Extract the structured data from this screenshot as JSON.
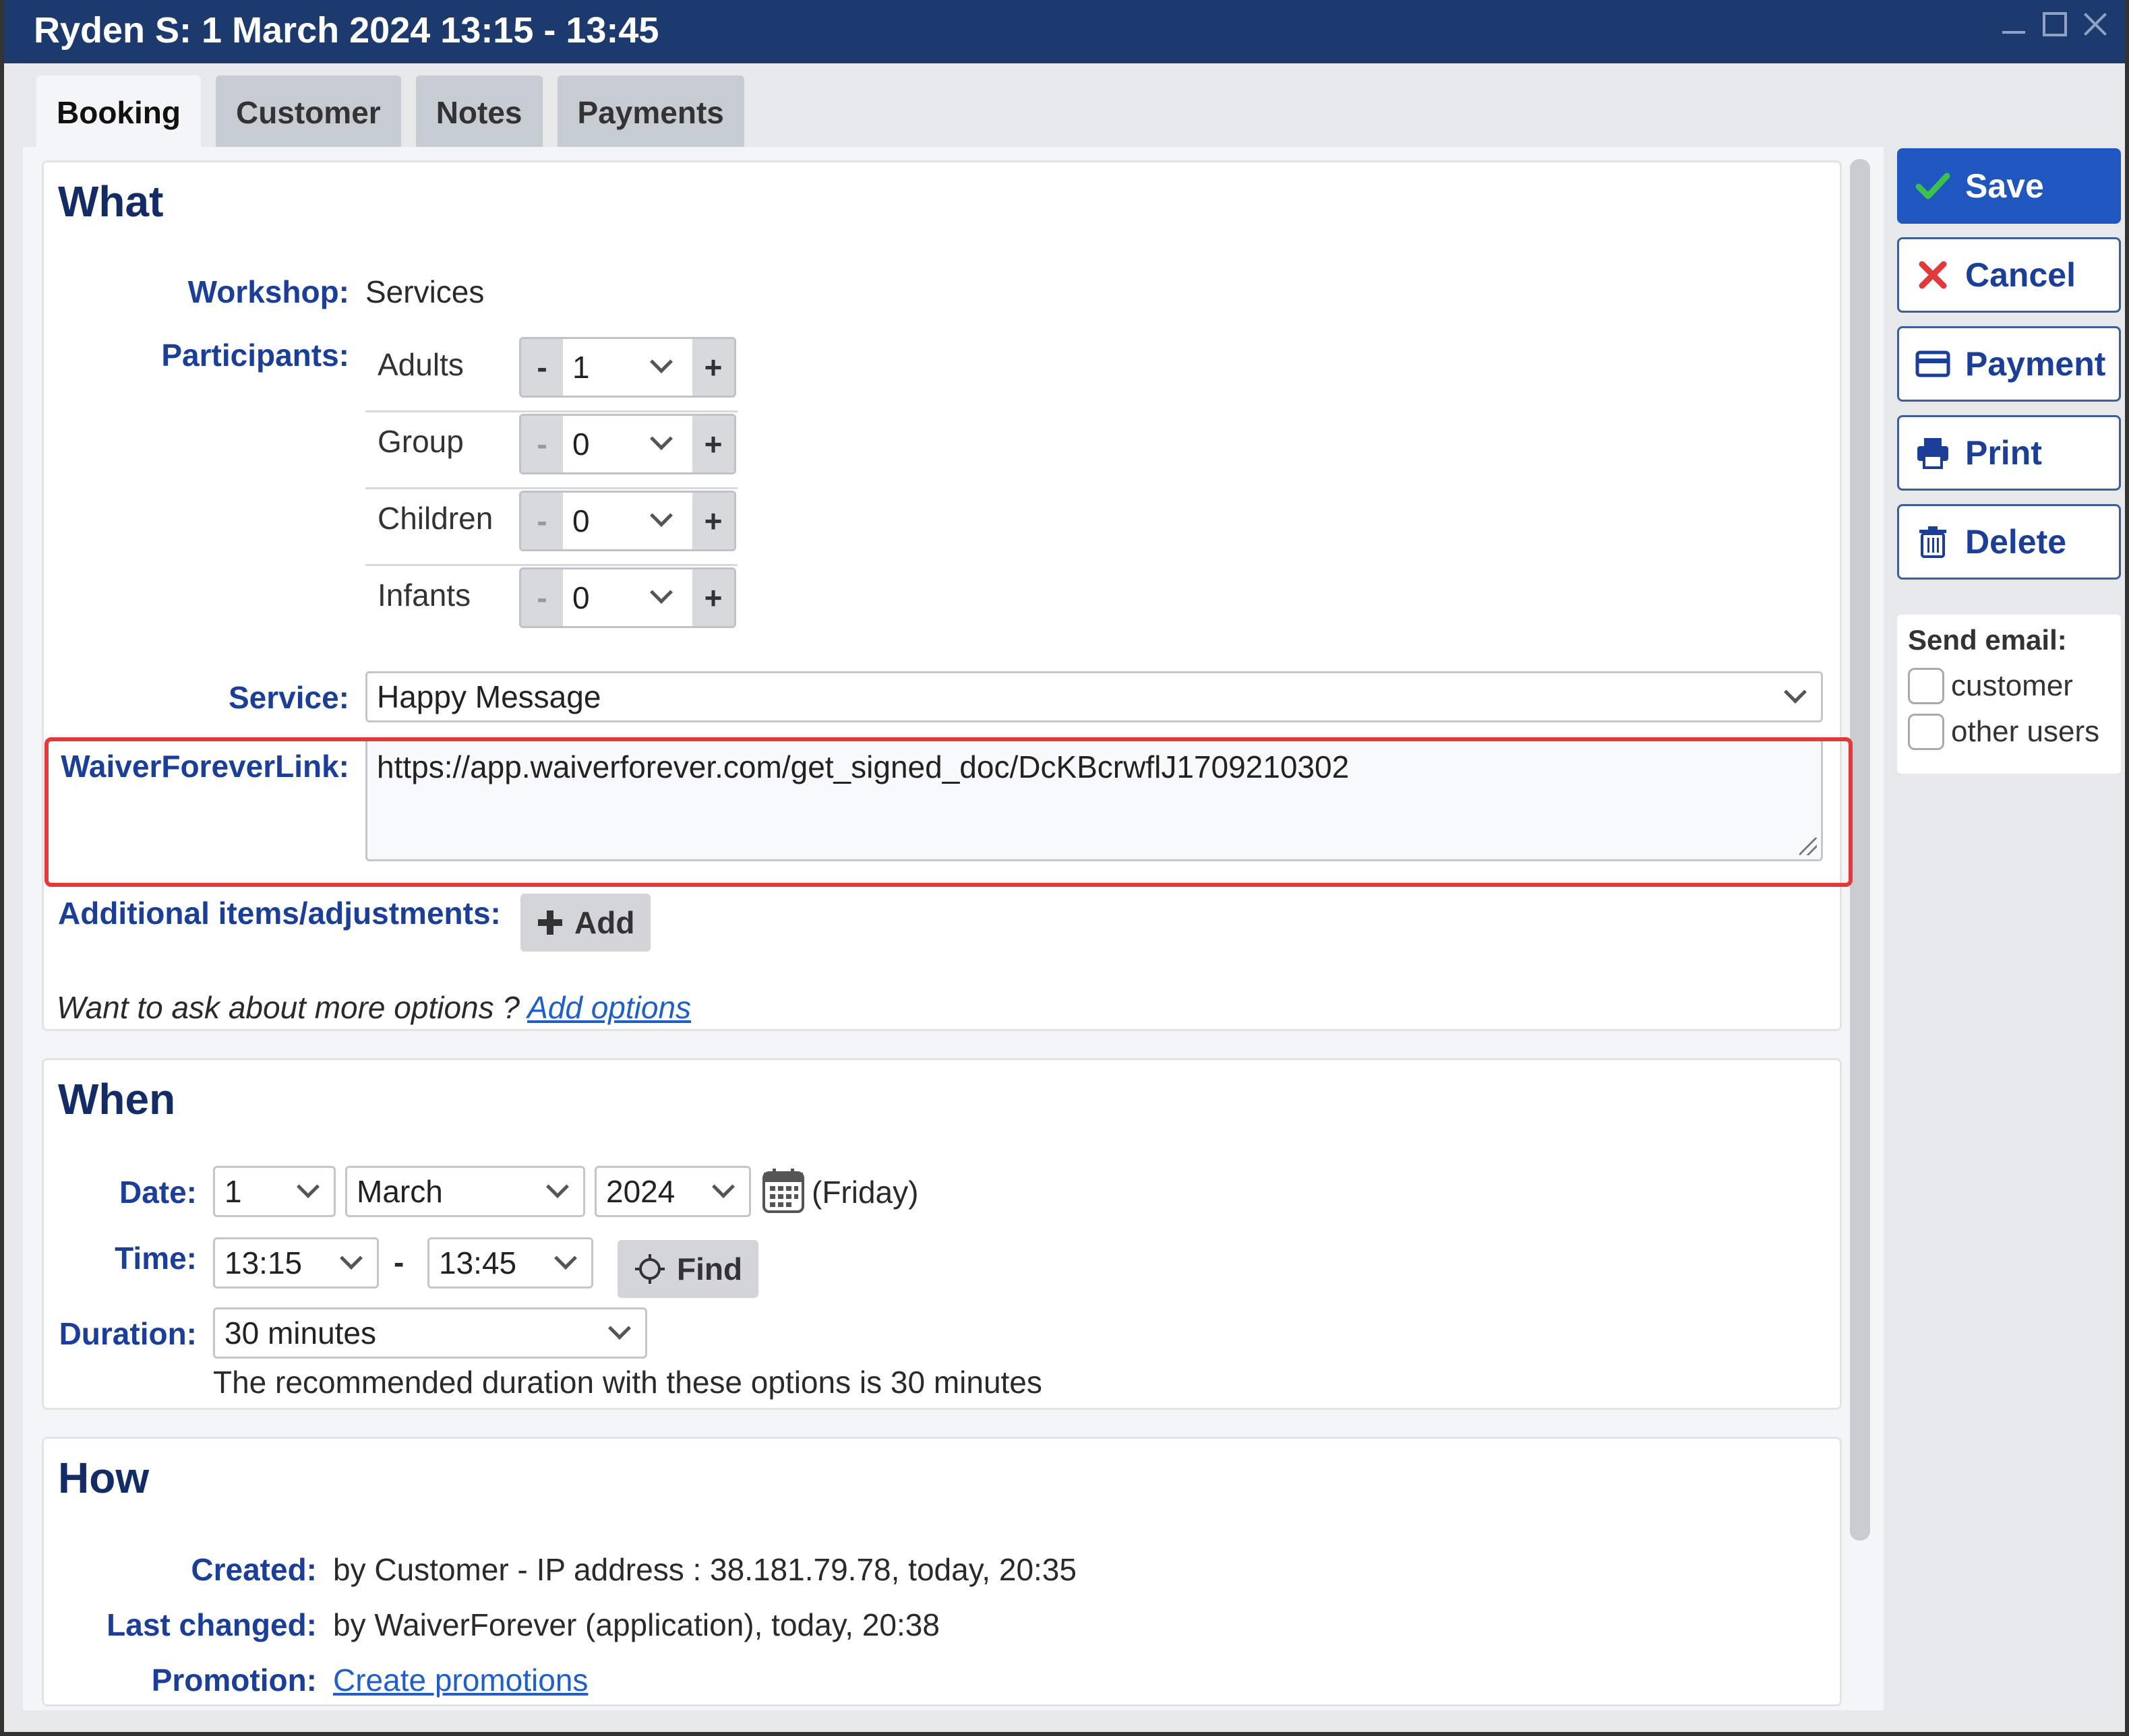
{
  "window": {
    "title": "Ryden S: 1 March 2024 13:15 - 13:45"
  },
  "tabs": [
    {
      "label": "Booking"
    },
    {
      "label": "Customer"
    },
    {
      "label": "Notes"
    },
    {
      "label": "Payments"
    }
  ],
  "what": {
    "heading": "What",
    "workshop_label": "Workshop:",
    "workshop_value": "Services",
    "participants_label": "Participants:",
    "participants": [
      {
        "name": "Adults",
        "value": "1"
      },
      {
        "name": "Group",
        "value": "0"
      },
      {
        "name": "Children",
        "value": "0"
      },
      {
        "name": "Infants",
        "value": "0"
      }
    ],
    "minus": "-",
    "plus": "+",
    "service_label": "Service:",
    "service_value": "Happy Message",
    "waiver_label": "WaiverForeverLink:",
    "waiver_value": "https://app.waiverforever.com/get_signed_doc/DcKBcrwflJ1709210302",
    "additional_label": "Additional items/adjustments:",
    "add_button": "Add",
    "options_question": "Want to ask about more options ?",
    "options_link": "Add options"
  },
  "when": {
    "heading": "When",
    "date_label": "Date:",
    "day": "1",
    "month": "March",
    "year": "2024",
    "weekday": "(Friday)",
    "time_label": "Time:",
    "time_start": "13:15",
    "time_sep": "-",
    "time_end": "13:45",
    "find_button": "Find",
    "duration_label": "Duration:",
    "duration_value": "30 minutes",
    "duration_note": "The recommended duration with these options is 30 minutes"
  },
  "how": {
    "heading": "How",
    "created_label": "Created:",
    "created_value": "by Customer - IP address : 38.181.79.78, today, 20:35",
    "changed_label": "Last changed:",
    "changed_value": "by WaiverForever (application), today, 20:38",
    "promotion_label": "Promotion:",
    "promotion_link": "Create promotions"
  },
  "actions": {
    "save": "Save",
    "cancel": "Cancel",
    "payment": "Payment",
    "print": "Print",
    "delete": "Delete"
  },
  "send_email": {
    "title": "Send email:",
    "options": [
      {
        "label": "customer",
        "checked": false
      },
      {
        "label": "other users",
        "checked": false
      }
    ]
  },
  "colors": {
    "titlebar": "#1d3a6e",
    "label": "#1b3f98",
    "save_button": "#1f56bf",
    "highlight": "#e5383b",
    "link": "#1f5fc8"
  }
}
